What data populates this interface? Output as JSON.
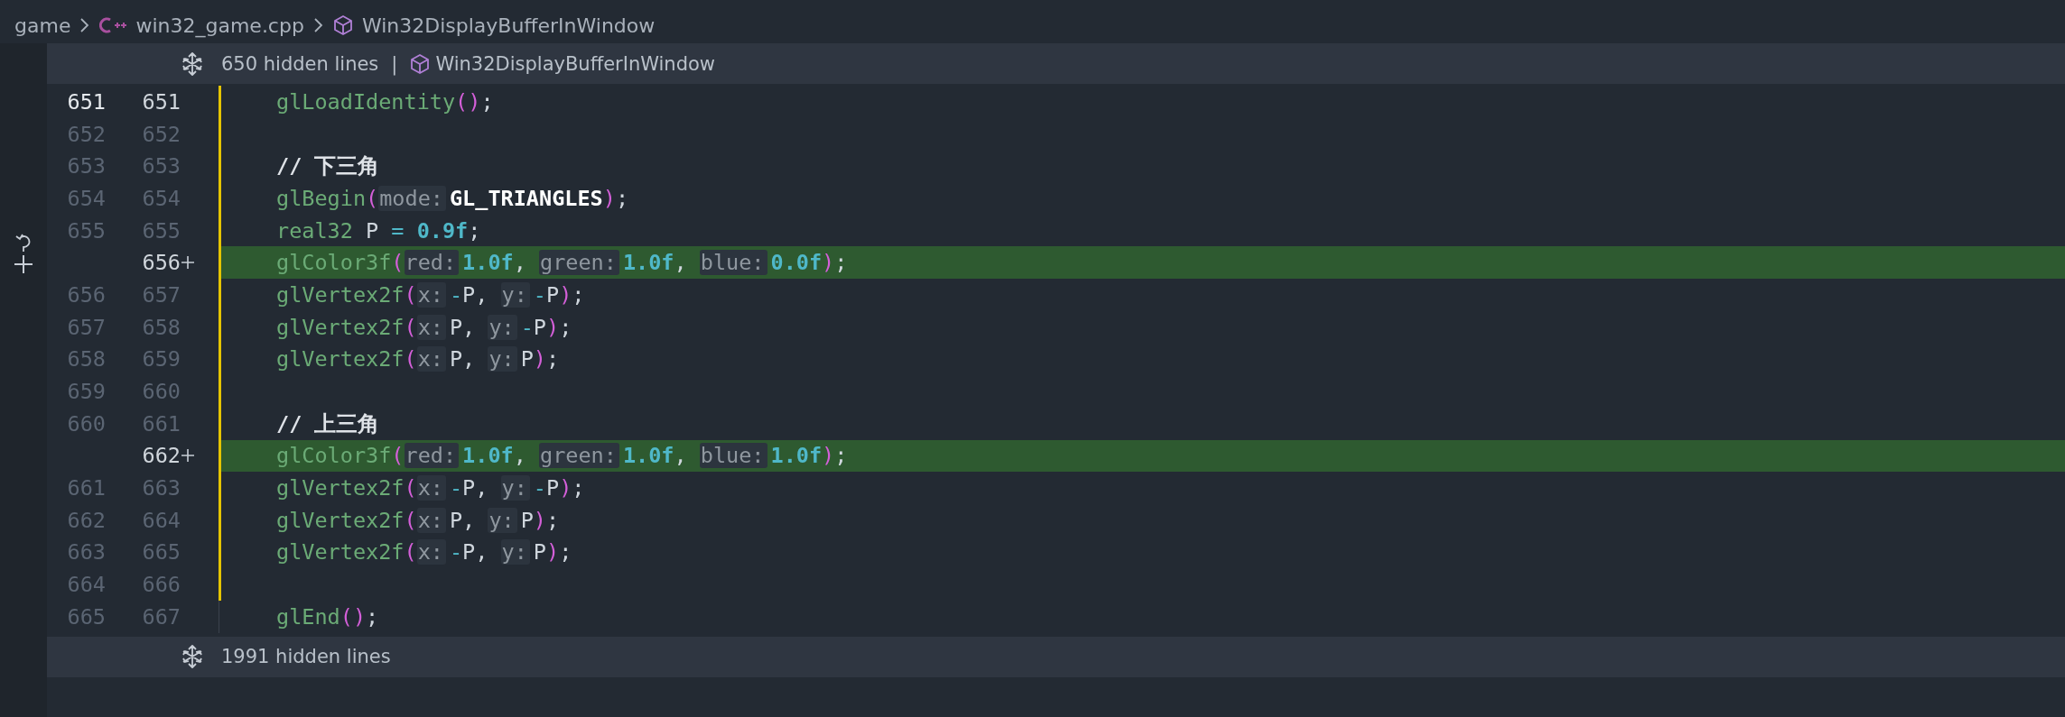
{
  "breadcrumb": {
    "folder": "game",
    "file": "win32_game.cpp",
    "symbol": "Win32DisplayBufferInWindow"
  },
  "top_fold": {
    "label": "650 hidden lines",
    "separator": "|",
    "symbol": "Win32DisplayBufferInWindow"
  },
  "lines": [
    {
      "old": "651",
      "new": "651",
      "current": true,
      "added": false,
      "tokens": [
        {
          "kind": "fn",
          "text": "glLoadIdentity"
        },
        {
          "kind": "paren",
          "text": "()"
        },
        {
          "kind": "punct",
          "text": ";"
        }
      ]
    },
    {
      "old": "652",
      "new": "652",
      "current": false,
      "added": false
    },
    {
      "old": "653",
      "new": "653",
      "current": false,
      "added": false,
      "tokens": [
        {
          "kind": "comment",
          "text": "// 下三角"
        }
      ]
    },
    {
      "old": "654",
      "new": "654",
      "current": false,
      "added": false,
      "tokens": [
        {
          "kind": "fn",
          "text": "glBegin"
        },
        {
          "kind": "paren",
          "text": "("
        },
        {
          "kind": "hint",
          "text": "mode:"
        },
        {
          "kind": "const",
          "text": "GL_TRIANGLES"
        },
        {
          "kind": "paren",
          "text": ")"
        },
        {
          "kind": "punct",
          "text": ";"
        }
      ]
    },
    {
      "old": "655",
      "new": "655",
      "current": false,
      "added": false,
      "tokens": [
        {
          "kind": "type",
          "text": "real32"
        },
        {
          "kind": "id",
          "text": " P"
        },
        {
          "kind": "op",
          "text": " = "
        },
        {
          "kind": "num",
          "text": "0.9f"
        },
        {
          "kind": "punct",
          "text": ";"
        }
      ]
    },
    {
      "new": "656",
      "current": false,
      "added": true,
      "tokens": [
        {
          "kind": "fn",
          "text": "glColor3f"
        },
        {
          "kind": "paren",
          "text": "("
        },
        {
          "kind": "hint",
          "text": "red:"
        },
        {
          "kind": "num",
          "text": "1.0f"
        },
        {
          "kind": "punct",
          "text": ", "
        },
        {
          "kind": "hint",
          "text": "green:"
        },
        {
          "kind": "num",
          "text": "1.0f"
        },
        {
          "kind": "punct",
          "text": ", "
        },
        {
          "kind": "hint",
          "text": "blue:"
        },
        {
          "kind": "num",
          "text": "0.0f"
        },
        {
          "kind": "paren",
          "text": ")"
        },
        {
          "kind": "punct",
          "text": ";"
        }
      ]
    },
    {
      "old": "656",
      "new": "657",
      "current": false,
      "added": false,
      "tokens": [
        {
          "kind": "fn",
          "text": "glVertex2f"
        },
        {
          "kind": "paren",
          "text": "("
        },
        {
          "kind": "hint",
          "text": "x:"
        },
        {
          "kind": "op",
          "text": "-"
        },
        {
          "kind": "id",
          "text": "P"
        },
        {
          "kind": "punct",
          "text": ", "
        },
        {
          "kind": "hint",
          "text": "y:"
        },
        {
          "kind": "op",
          "text": "-"
        },
        {
          "kind": "id",
          "text": "P"
        },
        {
          "kind": "paren",
          "text": ")"
        },
        {
          "kind": "punct",
          "text": ";"
        }
      ]
    },
    {
      "old": "657",
      "new": "658",
      "current": false,
      "added": false,
      "tokens": [
        {
          "kind": "fn",
          "text": "glVertex2f"
        },
        {
          "kind": "paren",
          "text": "("
        },
        {
          "kind": "hint",
          "text": "x:"
        },
        {
          "kind": "id",
          "text": "P"
        },
        {
          "kind": "punct",
          "text": ", "
        },
        {
          "kind": "hint",
          "text": "y:"
        },
        {
          "kind": "op",
          "text": "-"
        },
        {
          "kind": "id",
          "text": "P"
        },
        {
          "kind": "paren",
          "text": ")"
        },
        {
          "kind": "punct",
          "text": ";"
        }
      ]
    },
    {
      "old": "658",
      "new": "659",
      "current": false,
      "added": false,
      "tokens": [
        {
          "kind": "fn",
          "text": "glVertex2f"
        },
        {
          "kind": "paren",
          "text": "("
        },
        {
          "kind": "hint",
          "text": "x:"
        },
        {
          "kind": "id",
          "text": "P"
        },
        {
          "kind": "punct",
          "text": ", "
        },
        {
          "kind": "hint",
          "text": "y:"
        },
        {
          "kind": "id",
          "text": "P"
        },
        {
          "kind": "paren",
          "text": ")"
        },
        {
          "kind": "punct",
          "text": ";"
        }
      ]
    },
    {
      "old": "659",
      "new": "660",
      "current": false,
      "added": false
    },
    {
      "old": "660",
      "new": "661",
      "current": false,
      "added": false,
      "tokens": [
        {
          "kind": "comment",
          "text": "// 上三角"
        }
      ]
    },
    {
      "new": "662",
      "current": false,
      "added": true,
      "tokens": [
        {
          "kind": "fn",
          "text": "glColor3f"
        },
        {
          "kind": "paren",
          "text": "("
        },
        {
          "kind": "hint",
          "text": "red:"
        },
        {
          "kind": "num",
          "text": "1.0f"
        },
        {
          "kind": "punct",
          "text": ", "
        },
        {
          "kind": "hint",
          "text": "green:"
        },
        {
          "kind": "num",
          "text": "1.0f"
        },
        {
          "kind": "punct",
          "text": ", "
        },
        {
          "kind": "hint",
          "text": "blue:"
        },
        {
          "kind": "num",
          "text": "1.0f"
        },
        {
          "kind": "paren",
          "text": ")"
        },
        {
          "kind": "punct",
          "text": ";"
        }
      ]
    },
    {
      "old": "661",
      "new": "663",
      "current": false,
      "added": false,
      "tokens": [
        {
          "kind": "fn",
          "text": "glVertex2f"
        },
        {
          "kind": "paren",
          "text": "("
        },
        {
          "kind": "hint",
          "text": "x:"
        },
        {
          "kind": "op",
          "text": "-"
        },
        {
          "kind": "id",
          "text": "P"
        },
        {
          "kind": "punct",
          "text": ", "
        },
        {
          "kind": "hint",
          "text": "y:"
        },
        {
          "kind": "op",
          "text": "-"
        },
        {
          "kind": "id",
          "text": "P"
        },
        {
          "kind": "paren",
          "text": ")"
        },
        {
          "kind": "punct",
          "text": ";"
        }
      ]
    },
    {
      "old": "662",
      "new": "664",
      "current": false,
      "added": false,
      "tokens": [
        {
          "kind": "fn",
          "text": "glVertex2f"
        },
        {
          "kind": "paren",
          "text": "("
        },
        {
          "kind": "hint",
          "text": "x:"
        },
        {
          "kind": "id",
          "text": "P"
        },
        {
          "kind": "punct",
          "text": ", "
        },
        {
          "kind": "hint",
          "text": "y:"
        },
        {
          "kind": "id",
          "text": "P"
        },
        {
          "kind": "paren",
          "text": ")"
        },
        {
          "kind": "punct",
          "text": ";"
        }
      ]
    },
    {
      "old": "663",
      "new": "665",
      "current": false,
      "added": false,
      "tokens": [
        {
          "kind": "fn",
          "text": "glVertex2f"
        },
        {
          "kind": "paren",
          "text": "("
        },
        {
          "kind": "hint",
          "text": "x:"
        },
        {
          "kind": "op",
          "text": "-"
        },
        {
          "kind": "id",
          "text": "P"
        },
        {
          "kind": "punct",
          "text": ", "
        },
        {
          "kind": "hint",
          "text": "y:"
        },
        {
          "kind": "id",
          "text": "P"
        },
        {
          "kind": "paren",
          "text": ")"
        },
        {
          "kind": "punct",
          "text": ";"
        }
      ]
    },
    {
      "old": "664",
      "new": "666",
      "current": false,
      "added": false
    },
    {
      "old": "665",
      "new": "667",
      "current": false,
      "added": false,
      "tokens": [
        {
          "kind": "fn",
          "text": "glEnd"
        },
        {
          "kind": "paren",
          "text": "()"
        },
        {
          "kind": "punct",
          "text": ";"
        }
      ]
    }
  ],
  "bottom_fold": {
    "label": "1991 hidden lines"
  }
}
